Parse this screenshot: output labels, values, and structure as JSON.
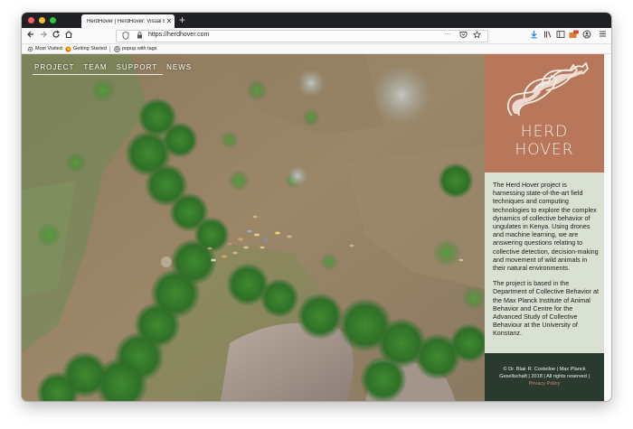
{
  "browser": {
    "tab_title": "HerdHover | HerdHover: Visual Eco",
    "tab_close": "✕",
    "new_tab": "+",
    "url": "https://herdhover.com",
    "nav_icons": [
      "arrow-left-icon",
      "arrow-right-icon",
      "reload-icon",
      "home-icon"
    ],
    "url_more": "···",
    "bookmarks": [
      {
        "label": "Most Visited",
        "icon": "gear-icon"
      },
      {
        "label": "Getting Started",
        "icon": "firefox-icon"
      },
      {
        "label": "popup with tags",
        "icon": "globe-icon"
      }
    ]
  },
  "site": {
    "nav": [
      "PROJECT",
      "TEAM",
      "SUPPORT",
      "NEWS"
    ],
    "logo": {
      "line1": "HERD",
      "line2": "HOVER"
    },
    "intro": "The Herd Hover project is harnessing state-of-the-art field techniques and computing technologies to explore the complex dynamics of collective behavior of ungulates in Kenya. Using drones and machine learning, we are answering questions relating to collective detection, decision-making and movement of wild animals in their natural environments.",
    "based": "The project is based in the Department of Collective Behavior at the Max Planck Institute of Animal Behavior and Centre for the Advanced Study of Collective Behaviour at the University of Konstanz.",
    "footer": {
      "copyright": "© Dr. Blair R. Costelloe | Max Planck Gesellschaft | 2018 | All rights reserved | ",
      "privacy": "Privacy Policy"
    }
  },
  "colors": {
    "logo_bg": "#b8775a",
    "text_panel_bg": "#d6decf",
    "footer_bg": "#2a3a2f",
    "privacy_link": "#d28d6a",
    "titlebar": "#202124"
  }
}
